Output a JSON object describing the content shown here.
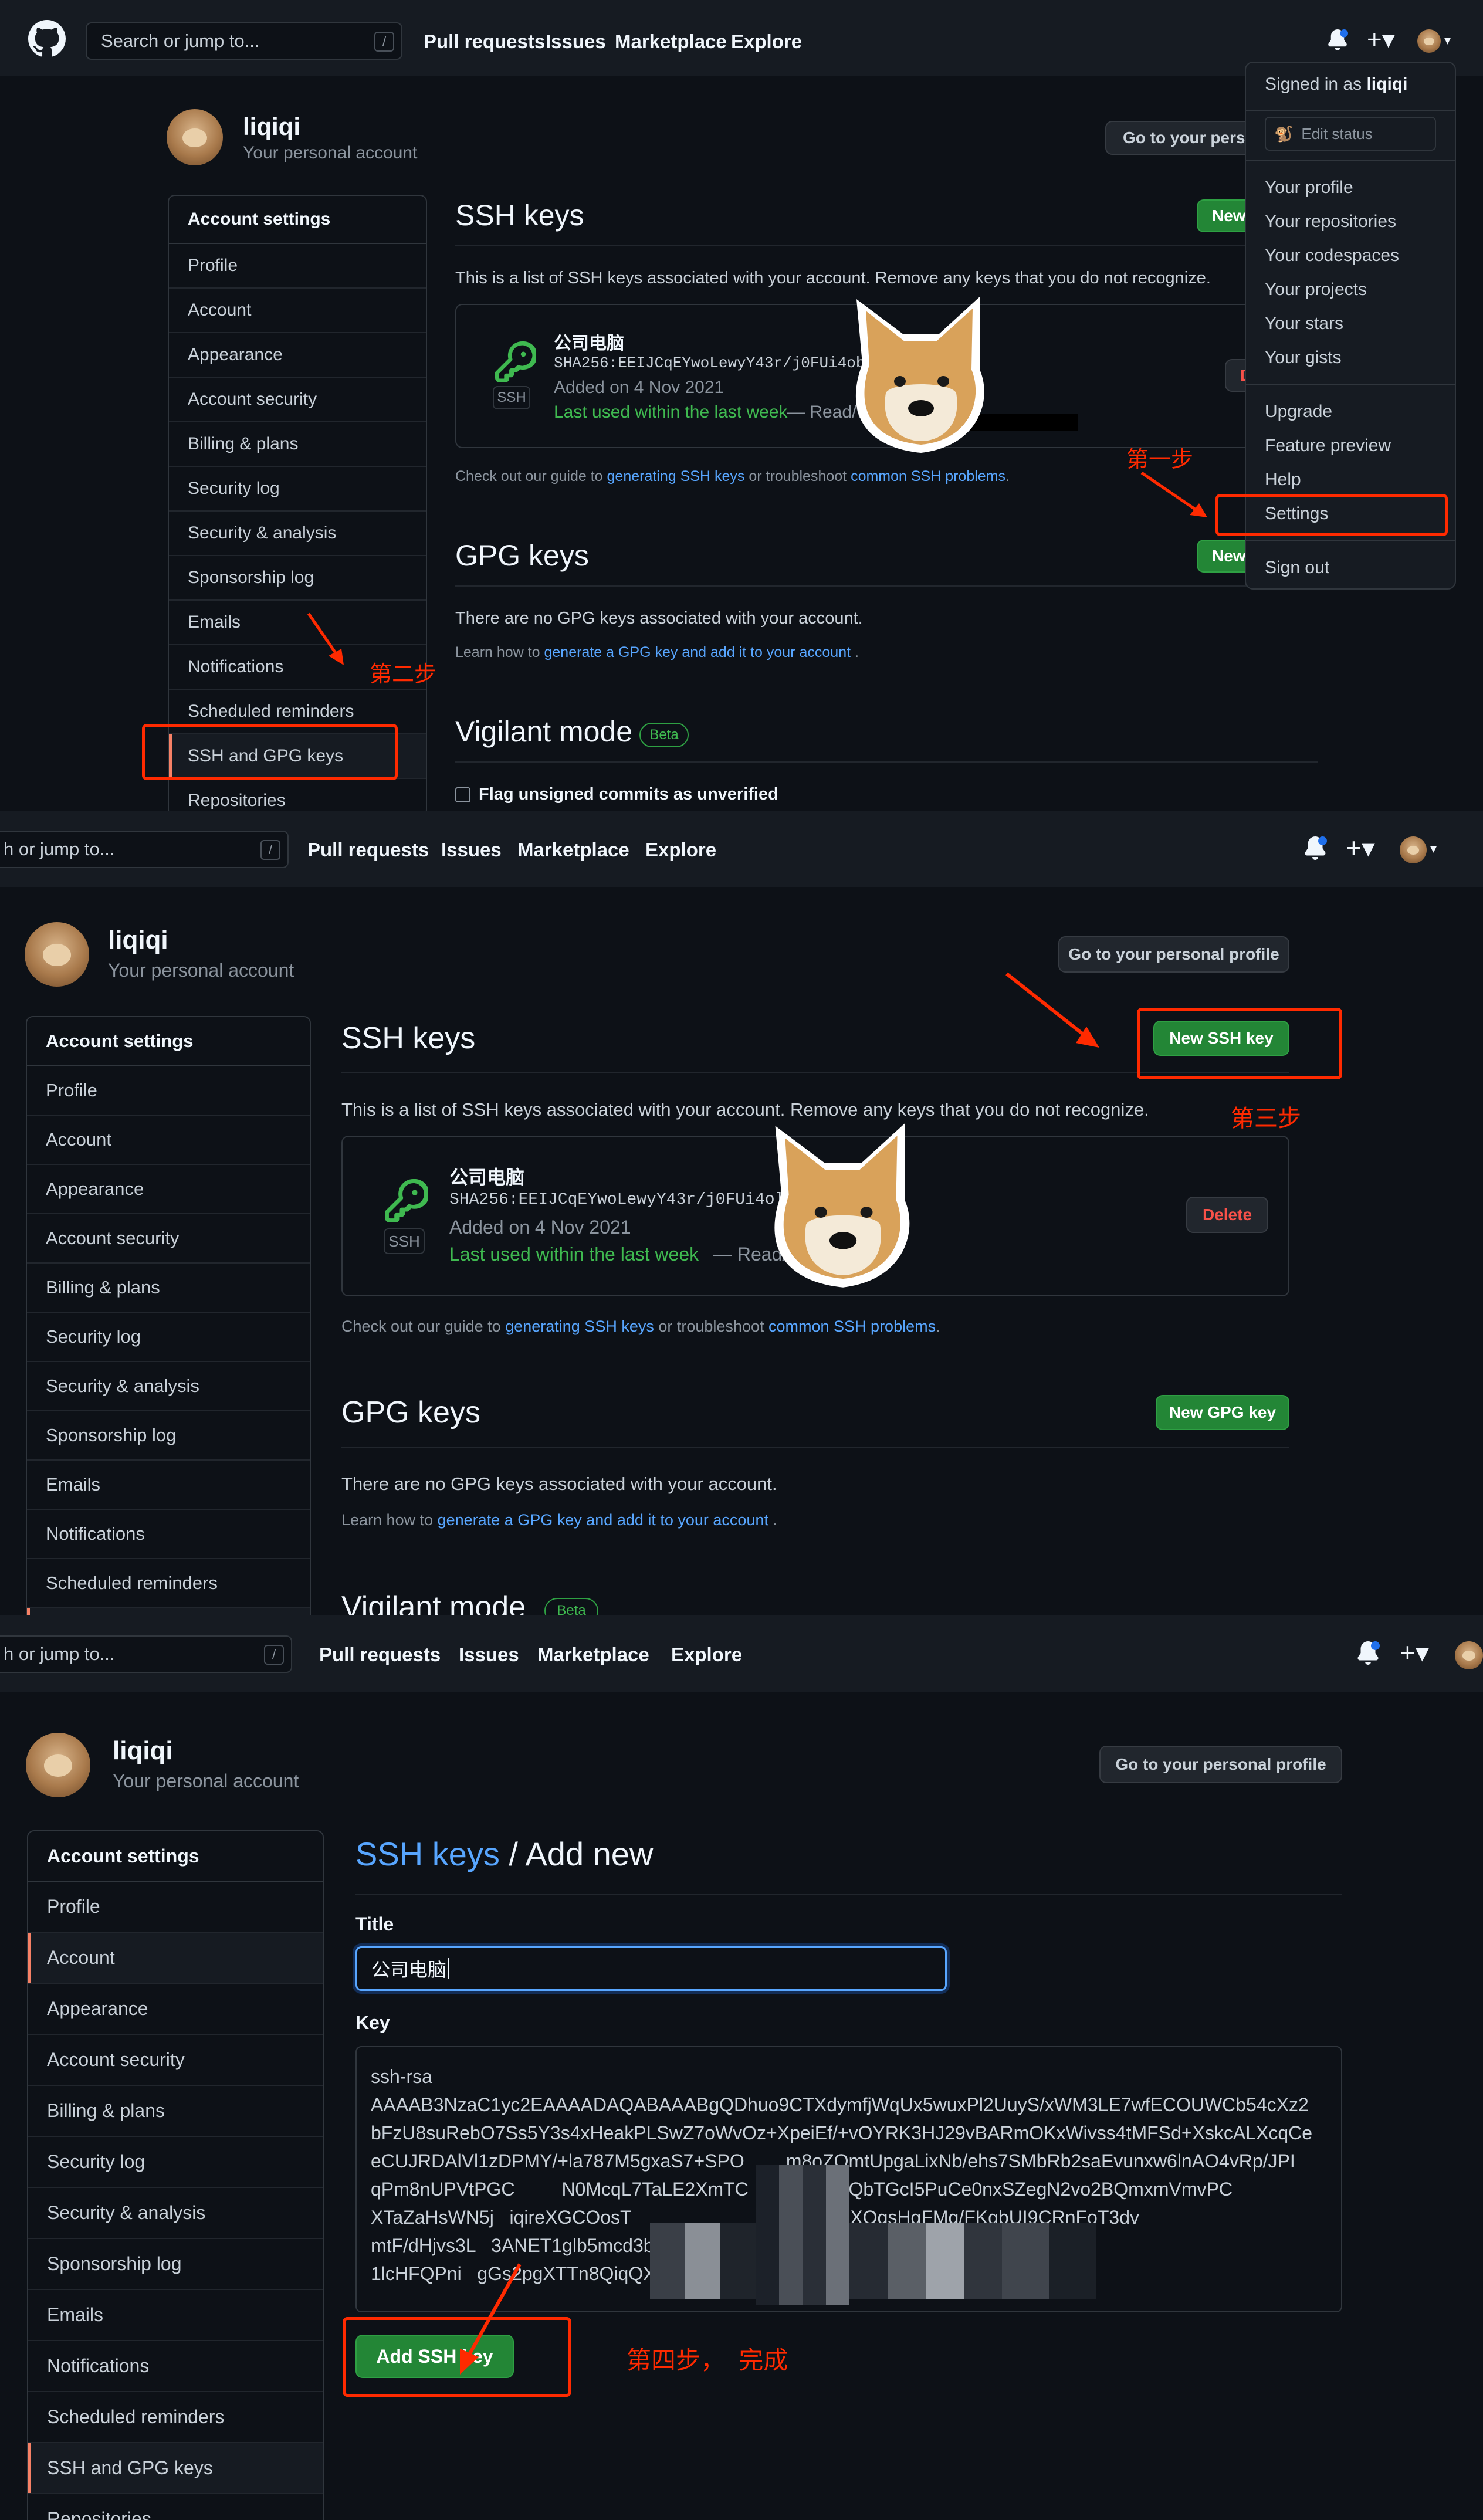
{
  "colors": {
    "bg": "#0d1117",
    "header": "#161b22",
    "accent_green": "#238636",
    "link": "#58a6ff",
    "annotation_red": "#ff2a00",
    "danger": "#f85149"
  },
  "header": {
    "search_placeholder": "Search or jump to...",
    "search_placeholder_truncated": "h or jump to...",
    "slash_key": "/",
    "nav": [
      "Pull requests",
      "Issues",
      "Marketplace",
      "Explore"
    ]
  },
  "user": {
    "name": "liqiqi",
    "subtitle": "Your personal account",
    "profile_button": "Go to your personal profile",
    "profile_button_truncated": "Go to your persona"
  },
  "sidebar": {
    "heading": "Account settings",
    "items": [
      "Profile",
      "Account",
      "Appearance",
      "Account security",
      "Billing & plans",
      "Security log",
      "Security & analysis",
      "Sponsorship log",
      "Emails",
      "Notifications",
      "Scheduled reminders",
      "SSH and GPG keys",
      "Repositories",
      "Repositories"
    ],
    "selected": "SSH and GPG keys"
  },
  "dropdown": {
    "signed_in_prefix": "Signed in as",
    "signed_in_user": "liqiqi",
    "edit_status": "Edit status",
    "group1": [
      "Your profile",
      "Your repositories",
      "Your codespaces",
      "Your projects",
      "Your stars",
      "Your gists"
    ],
    "group2": [
      "Upgrade",
      "Feature preview",
      "Help",
      "Settings"
    ],
    "sign_out": "Sign out"
  },
  "ssh": {
    "title": "SSH keys",
    "new_button": "New SSH key",
    "new_button_truncated": "New",
    "description": "This is a list of SSH keys associated with your account. Remove any keys that you do not recognize.",
    "key_name": "公司电脑",
    "fingerprint": "SHA256:EEIJCqEYwoLewyY43r/j0FUi4obA",
    "fingerprint2": "SHA256:EEIJCqEYwoLewyY43r/j0FUi4ol",
    "fingerprint3": "SHA256:EEIJCqEYwoLewyY43r/j0FUi4ob",
    "badge": "SSH",
    "added": "Added on 4 Nov 2021",
    "last_used": "Last used within the last week",
    "access": "— Read/w",
    "access2": "— Read/",
    "delete_button": "Delete",
    "delete_truncated": "D",
    "guide_prefix": "Check out our guide to",
    "guide_link": "generating SSH keys",
    "guide_mid": "or troubleshoot",
    "guide_link2": "common SSH problems",
    "guide_end": "."
  },
  "gpg": {
    "title": "GPG keys",
    "new_button": "New GPG key",
    "new_button_truncated": "New",
    "empty": "There are no GPG keys associated with your account.",
    "learn_prefix": "Learn how to",
    "learn_link": "generate a GPG key and add it to your account",
    "learn_end": "."
  },
  "vigilant": {
    "title": "Vigilant mode",
    "badge": "Beta",
    "checkbox_label": "Flag unsigned commits as unverified"
  },
  "add_form": {
    "breadcrumb_link": "SSH keys",
    "breadcrumb_sep": "/",
    "breadcrumb_current": "Add new",
    "title_label": "Title",
    "title_value": "公司电脑",
    "key_label": "Key",
    "key_lines": [
      "ssh-rsa",
      "AAAAB3NzaC1yc2EAAAADAQABAAABgQDhuo9CTXdymfjWqUx5wuxPl2UuyS/xWM3LE7wfECOUWCb54cXz2",
      "bFzU8suRebO7Ss5Y3s4xHeakPLSwZ7oWvOz+XpeiEf/+vOYRK3HJ29vBARmOKxWivss4tMFSd+XskcALXcqCe",
      "eCUJRDAlVl1zDPMY/+la787M5gxaS7+SPO        m8oZOmtUpgaLixNb/ehs7SMbRb2saEvunxw6lnAO4vRp/JPI",
      "qPm8nUPVtPGC         N0McqL7TaLE2XmTC              GSQbTGcI5PuCe0nxSZegN2vo2BQmxmVmvPC",
      "XTaZaHsWN5j   iqireXGCOosT                          OgfKF1jOXQgsHqFMg/FKgbUI9CRnFoT3dv",
      "mtF/dHjvs3L   3ANET1glb5mcd3b/VqME                   SgZEas+b/odaa9hzQlZ+TUpGo",
      "1lcHFQPni   gGs2pgXTTn8QiqQX/qvQJMh"
    ],
    "submit": "Add SSH key"
  },
  "annotations": {
    "step1": "第一步",
    "step2": "第二步",
    "step3": "第三步",
    "step4": "第四步，  完成"
  }
}
